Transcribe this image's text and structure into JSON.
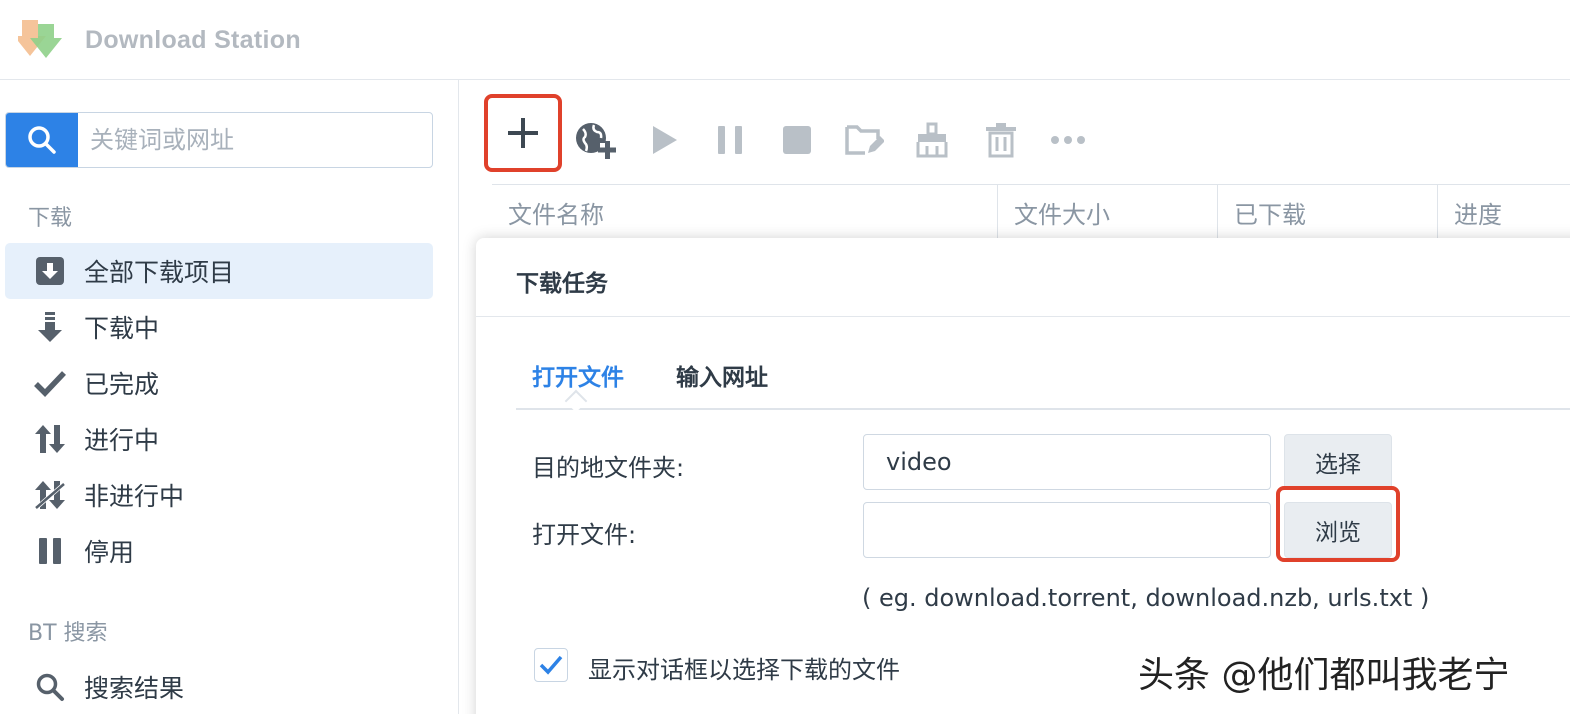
{
  "app": {
    "title": "Download Station"
  },
  "sidebar": {
    "search_placeholder": "关键词或网址",
    "section_download": "下载",
    "items": [
      {
        "label": "全部下载项目",
        "icon": "download-box-icon",
        "active": true
      },
      {
        "label": "下载中",
        "icon": "arrow-down-icon",
        "active": false
      },
      {
        "label": "已完成",
        "icon": "checkmark-icon",
        "active": false
      },
      {
        "label": "进行中",
        "icon": "up-down-arrows-icon",
        "active": false
      },
      {
        "label": "非进行中",
        "icon": "up-down-slashed-icon",
        "active": false
      },
      {
        "label": "停用",
        "icon": "pause-icon",
        "active": false
      }
    ],
    "section_bt": "BT 搜索",
    "bt_items": [
      {
        "label": "搜索结果",
        "icon": "search-icon"
      }
    ]
  },
  "toolbar": {
    "buttons": [
      "add-icon",
      "add-url-globe-icon",
      "play-icon",
      "pause-icon",
      "stop-icon",
      "edit-folder-icon",
      "clear-broom-icon",
      "trash-icon",
      "more-icon"
    ]
  },
  "table": {
    "columns": [
      "文件名称",
      "文件大小",
      "已下载",
      "进度"
    ]
  },
  "dialog": {
    "title": "下载任务",
    "tabs": [
      "打开文件",
      "输入网址"
    ],
    "destination_label": "目的地文件夹:",
    "destination_value": "video",
    "select_button": "选择",
    "open_file_label": "打开文件:",
    "open_file_value": "",
    "browse_button": "浏览",
    "hint": "( eg. download.torrent, download.nzb, urls.txt )",
    "show_dialog_checkbox_label": "显示对话框以选择下载的文件",
    "show_dialog_checked": true
  },
  "watermark": "头条 @他们都叫我老宁",
  "colors": {
    "accent": "#2d82e6",
    "highlight": "#e0412b",
    "active_nav_bg": "#e6f0fb",
    "icon_gray": "#6b7580"
  }
}
